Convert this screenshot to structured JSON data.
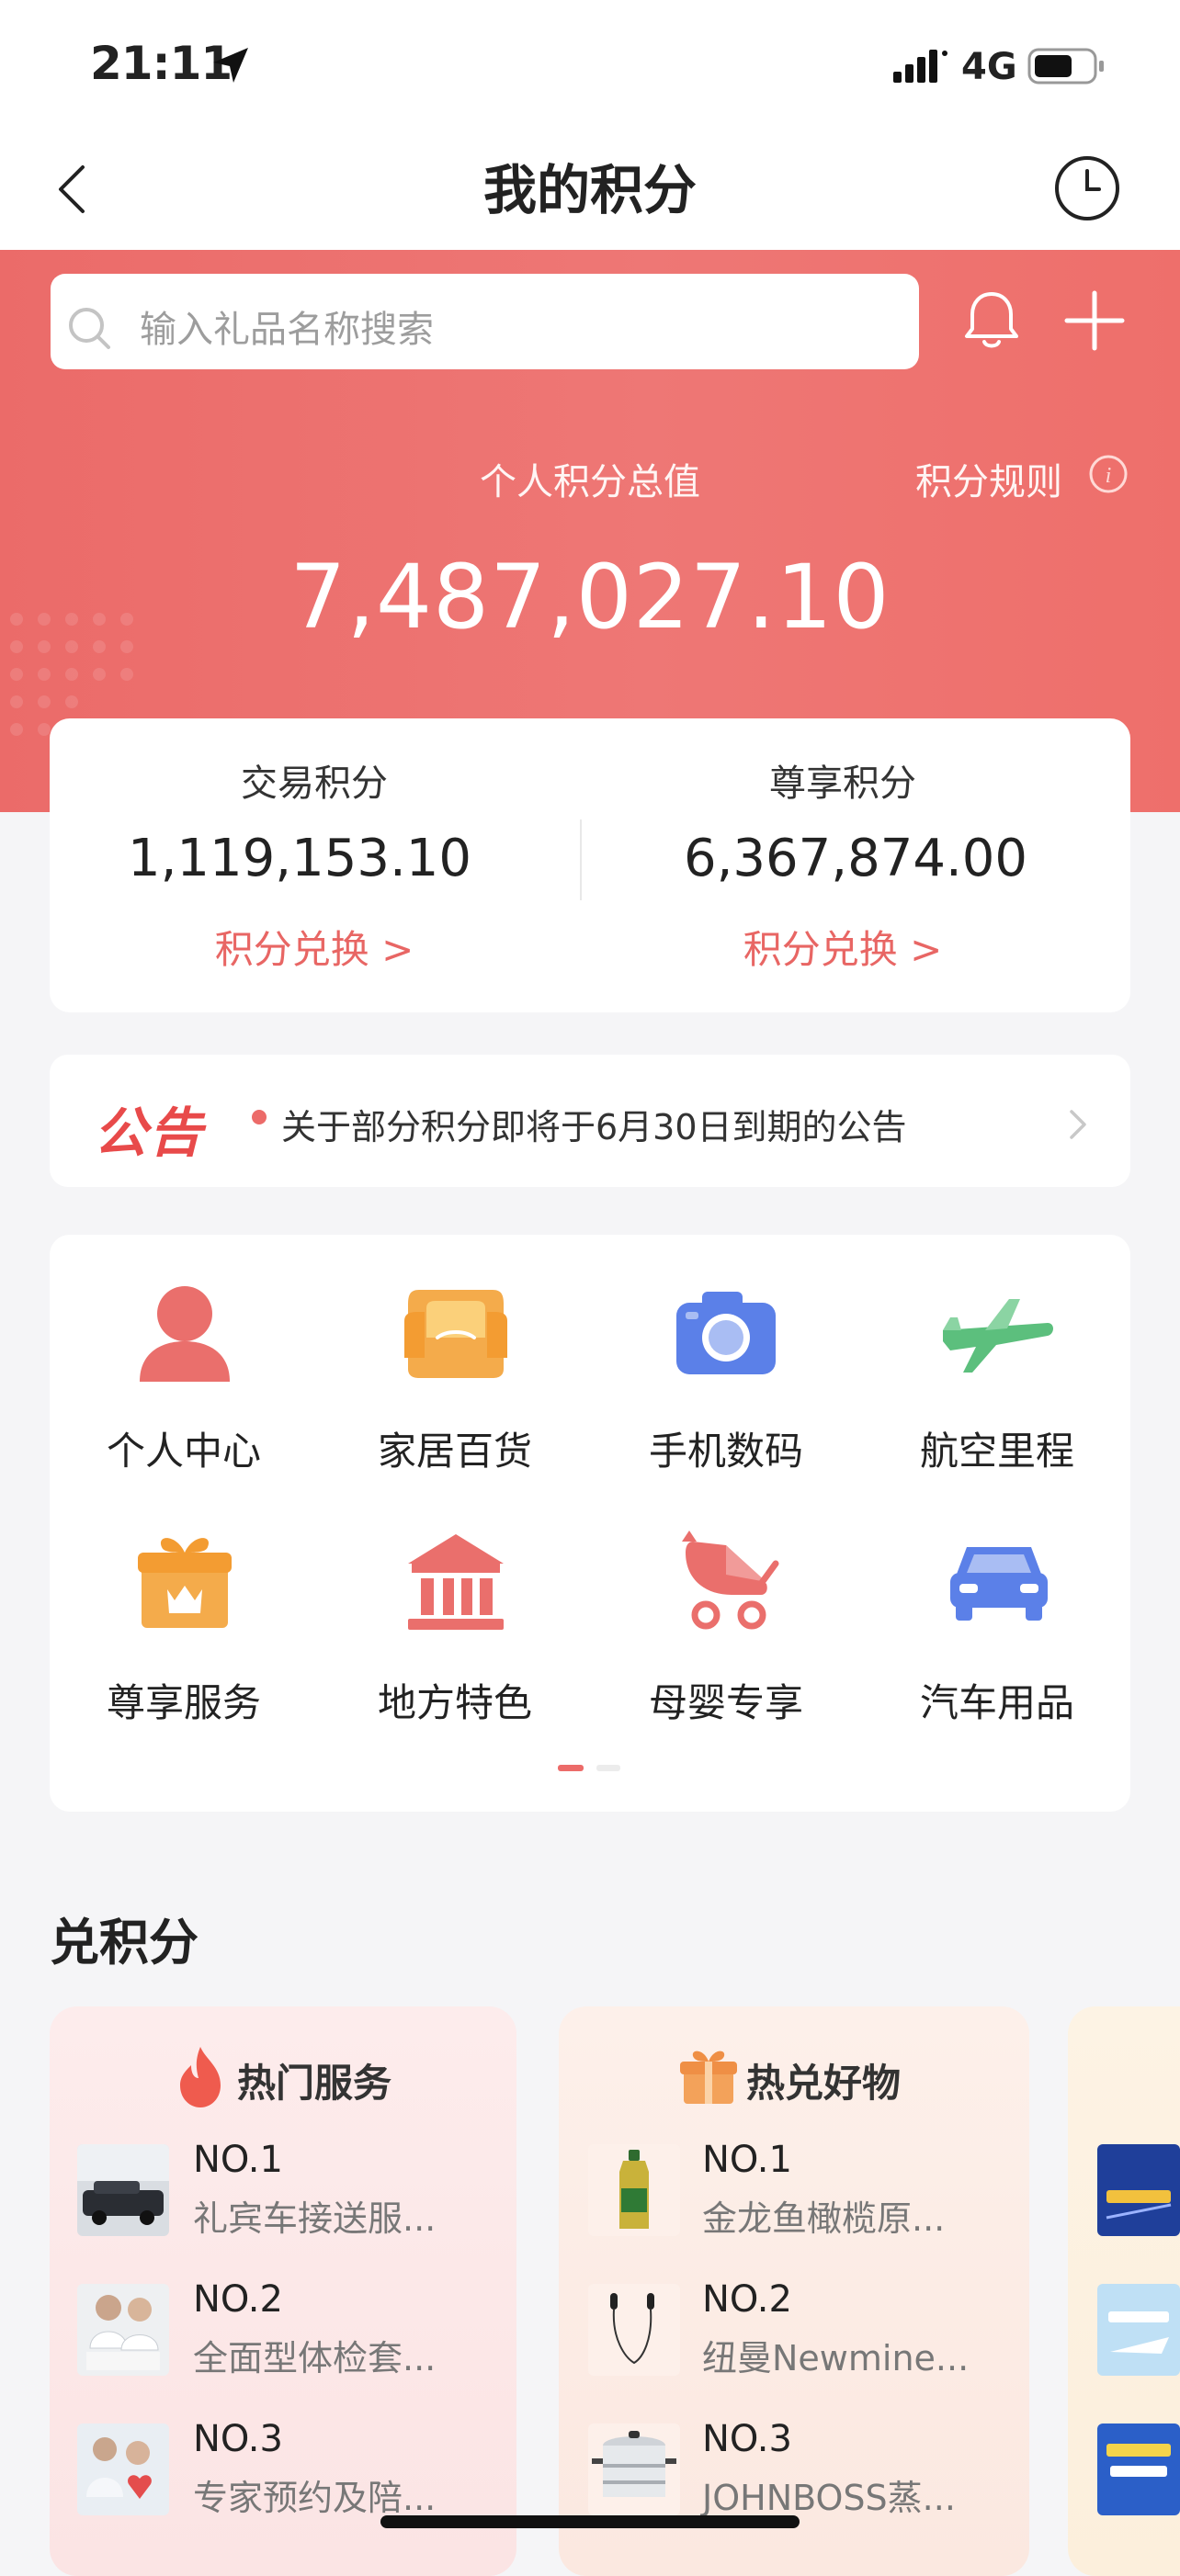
{
  "status_bar": {
    "time": "21:11",
    "network": "4G"
  },
  "nav": {
    "title": "我的积分"
  },
  "search": {
    "placeholder": "输入礼品名称搜索"
  },
  "summary": {
    "total_label": "个人积分总值",
    "rules_label": "积分规则",
    "total_value": "7,487,027.10"
  },
  "points": [
    {
      "label": "交易积分",
      "value": "1,119,153.10",
      "link": "积分兑换 >"
    },
    {
      "label": "尊享积分",
      "value": "6,367,874.00",
      "link": "积分兑换 >"
    }
  ],
  "notice": {
    "badge": "公告",
    "text": "关于部分积分即将于6月30日到期的公告"
  },
  "categories": [
    {
      "label": "个人中心",
      "icon": "person-icon"
    },
    {
      "label": "家居百货",
      "icon": "sofa-icon"
    },
    {
      "label": "手机数码",
      "icon": "camera-icon"
    },
    {
      "label": "航空里程",
      "icon": "airplane-icon"
    },
    {
      "label": "尊享服务",
      "icon": "gift-crown-icon"
    },
    {
      "label": "地方特色",
      "icon": "temple-icon"
    },
    {
      "label": "母婴专享",
      "icon": "stroller-icon"
    },
    {
      "label": "汽车用品",
      "icon": "car-icon"
    }
  ],
  "section": {
    "title": "兑积分"
  },
  "rankings": [
    {
      "title": "热门服务",
      "items": [
        {
          "rank": "NO.1",
          "name": "礼宾车接送服..."
        },
        {
          "rank": "NO.2",
          "name": "全面型体检套..."
        },
        {
          "rank": "NO.3",
          "name": "专家预约及陪..."
        }
      ]
    },
    {
      "title": "热兑好物",
      "items": [
        {
          "rank": "NO.1",
          "name": "金龙鱼橄榄原..."
        },
        {
          "rank": "NO.2",
          "name": "纽曼Newmine..."
        },
        {
          "rank": "NO.3",
          "name": "JOHNBOSS蒸..."
        }
      ]
    }
  ],
  "colors": {
    "brand_red": "#ec6b69",
    "link_red": "#e86664",
    "page_bg": "#f5f5f7"
  }
}
